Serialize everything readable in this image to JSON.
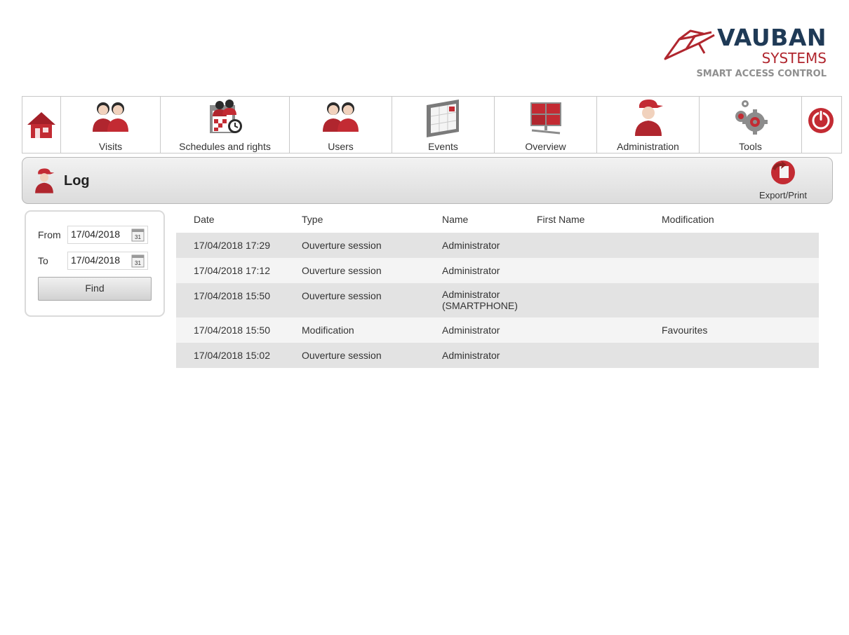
{
  "brand": {
    "name": "VAUBAN",
    "sub": "SYSTEMS",
    "tagline": "SMART ACCESS CONTROL",
    "colors": {
      "primary_red": "#b0262e",
      "navy": "#1f3a56"
    }
  },
  "nav": {
    "home_icon": "home-icon",
    "items": [
      {
        "label": "Visits",
        "icon": "visitors-icon"
      },
      {
        "label": "Schedules and rights",
        "icon": "schedule-icon"
      },
      {
        "label": "Users",
        "icon": "users-icon"
      },
      {
        "label": "Events",
        "icon": "events-icon"
      },
      {
        "label": "Overview",
        "icon": "overview-icon"
      },
      {
        "label": "Administration",
        "icon": "admin-icon"
      },
      {
        "label": "Tools",
        "icon": "gears-icon"
      }
    ],
    "power_icon": "power-icon"
  },
  "page": {
    "title": "Log",
    "export_label": "Export/Print"
  },
  "filter": {
    "from_label": "From",
    "from_value": "17/04/2018",
    "to_label": "To",
    "to_value": "17/04/2018",
    "calendar_glyph": "31",
    "find_label": "Find"
  },
  "table": {
    "headers": {
      "date": "Date",
      "type": "Type",
      "name": "Name",
      "first_name": "First Name",
      "modification": "Modification"
    },
    "rows": [
      {
        "date": "17/04/2018 17:29",
        "type": "Ouverture session",
        "name": "Administrator",
        "first_name": "",
        "modification": ""
      },
      {
        "date": "17/04/2018 17:12",
        "type": "Ouverture session",
        "name": "Administrator",
        "first_name": "",
        "modification": ""
      },
      {
        "date": "17/04/2018 15:50",
        "type": "Ouverture session",
        "name": "Administrator",
        "name2": "(SMARTPHONE)",
        "first_name": "",
        "modification": ""
      },
      {
        "date": "17/04/2018 15:50",
        "type": "Modification",
        "name": "Administrator",
        "first_name": "",
        "modification": "Favourites"
      },
      {
        "date": "17/04/2018 15:02",
        "type": "Ouverture session",
        "name": "Administrator",
        "first_name": "",
        "modification": ""
      }
    ]
  }
}
